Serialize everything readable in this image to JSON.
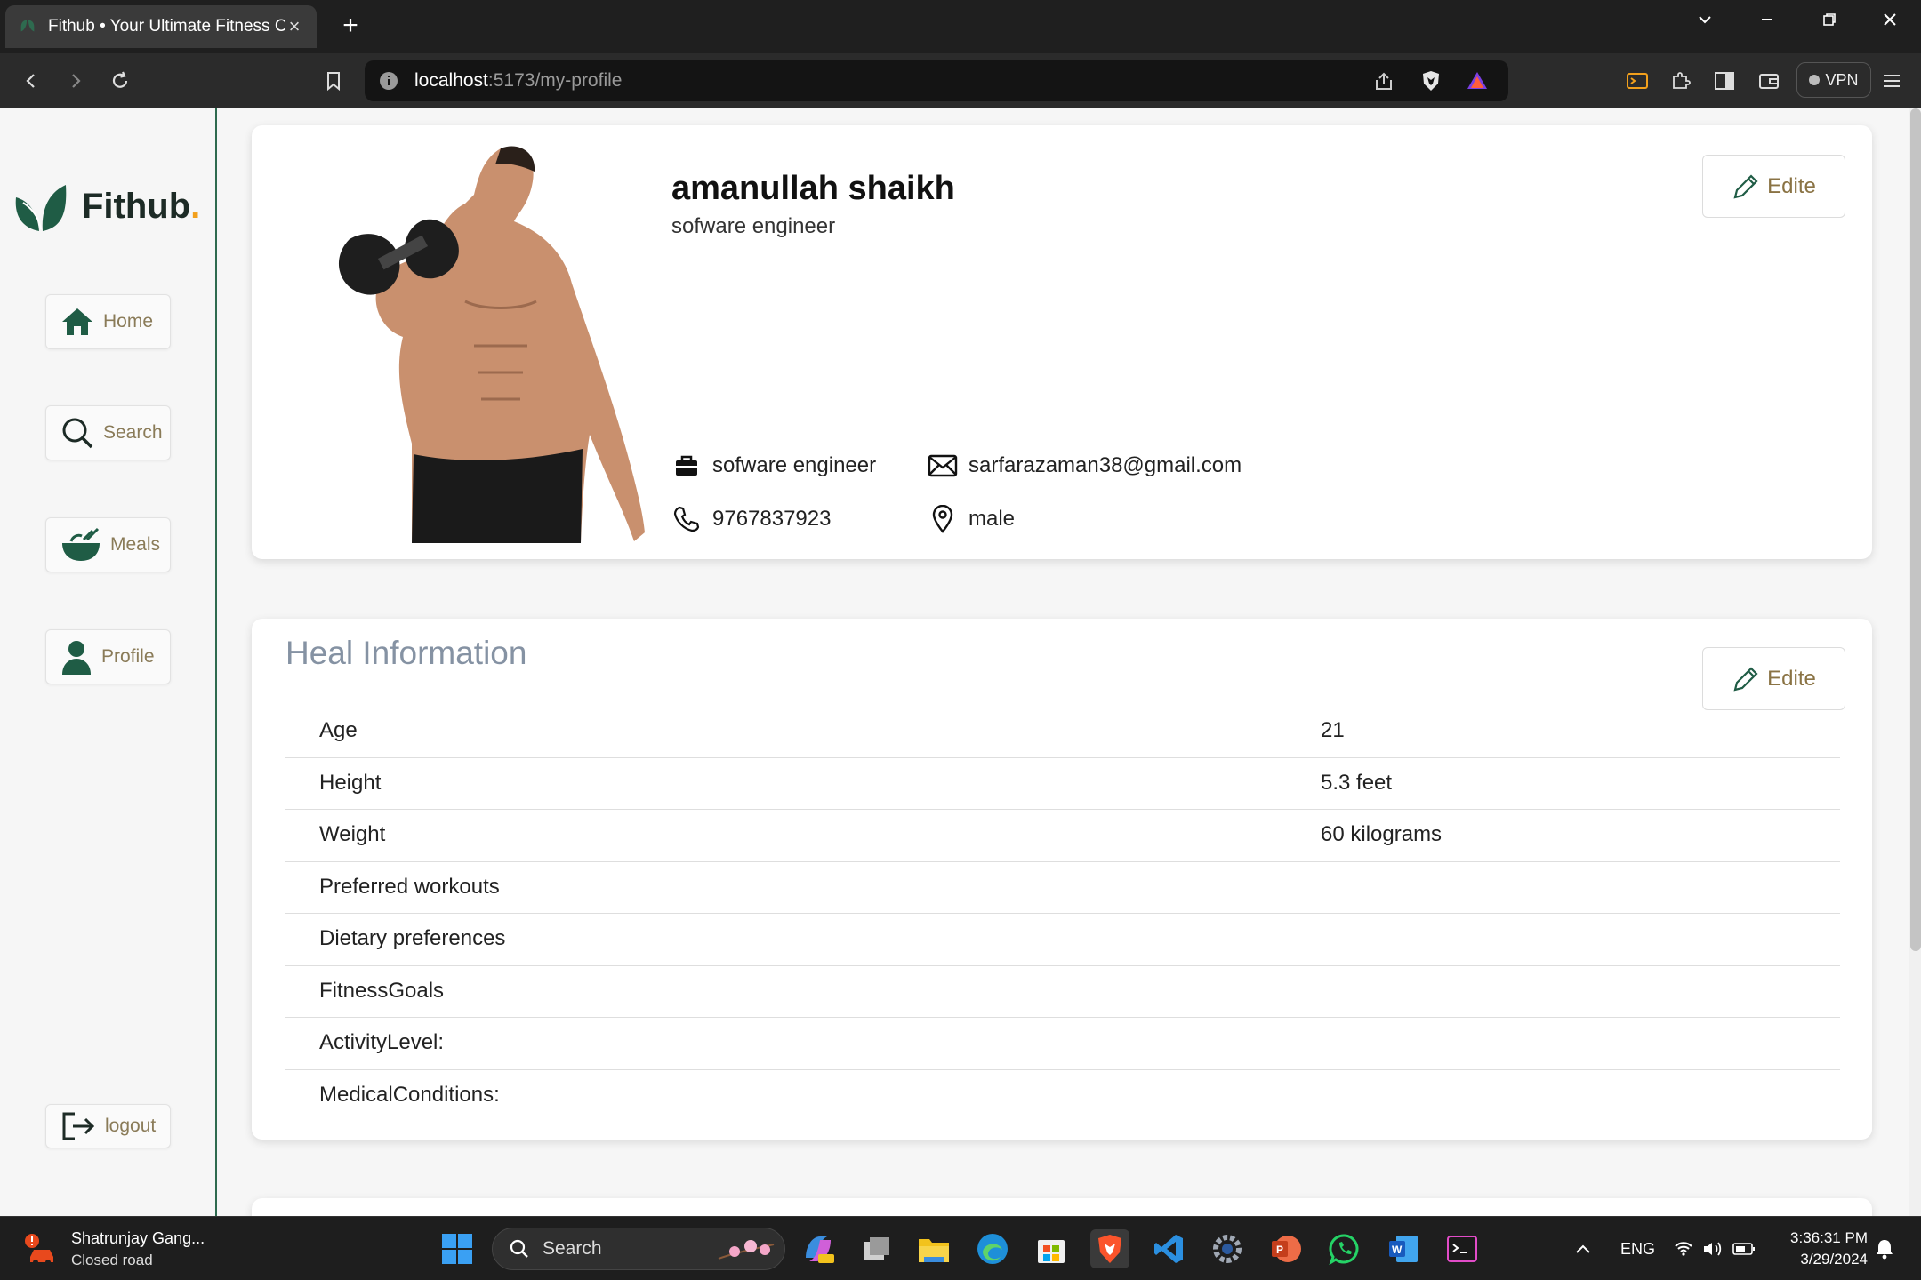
{
  "browser": {
    "tab_title": "Fithub • Your Ultimate Fitness Companion",
    "url_host": "localhost",
    "url_rest": ":5173/my-profile",
    "vpn_label": "VPN"
  },
  "sidebar": {
    "brand": "Fithub",
    "brand_dot": ".",
    "items": [
      {
        "label": "Home",
        "icon": "home-icon"
      },
      {
        "label": "Search",
        "icon": "search-icon"
      },
      {
        "label": "Meals",
        "icon": "bowl-icon"
      },
      {
        "label": "Profile",
        "icon": "user-icon"
      }
    ],
    "logout_label": "logout"
  },
  "profile": {
    "name": "amanullah shaikh",
    "title": "sofware engineer",
    "job": "sofware engineer",
    "email": "sarfarazaman38@gmail.com",
    "phone": "9767837923",
    "gender": "male",
    "edit_label": "Edite"
  },
  "health": {
    "title": "Heal Information",
    "edit_label": "Edite",
    "rows": [
      {
        "label": "Age",
        "value": "21"
      },
      {
        "label": "Height",
        "value": "5.3 feet"
      },
      {
        "label": "Weight",
        "value": "60 kilograms"
      },
      {
        "label": "Preferred workouts",
        "value": ""
      },
      {
        "label": "Dietary preferences",
        "value": ""
      },
      {
        "label": "FitnessGoals",
        "value": ""
      },
      {
        "label": "ActivityLevel:",
        "value": ""
      },
      {
        "label": "MedicalConditions:",
        "value": ""
      }
    ]
  },
  "taskbar": {
    "news_title": "Shatrunjay Gang...",
    "news_sub": "Closed road",
    "search_placeholder": "Search",
    "lang": "ENG",
    "time": "3:36:31 PM",
    "date": "3/29/2024"
  },
  "colors": {
    "brand_green": "#1f5c45",
    "accent_gold": "#8a7344"
  }
}
